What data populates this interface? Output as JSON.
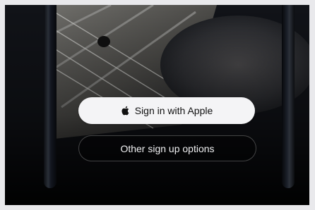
{
  "auth": {
    "primary_button": {
      "label": "Sign in with Apple",
      "icon": "apple-logo-icon"
    },
    "secondary_button": {
      "label": "Other sign up options"
    }
  },
  "colors": {
    "primary_button_bg": "#f4f4f6",
    "secondary_button_bg": "#00000059",
    "background": "#0b0d11",
    "frame": "#e9e9ec"
  }
}
